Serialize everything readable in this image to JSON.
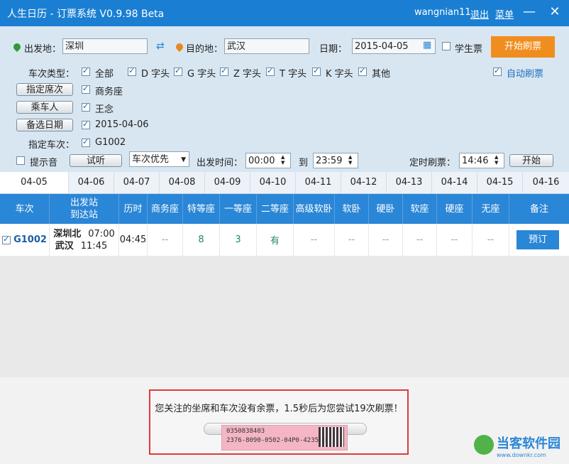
{
  "window": {
    "title": "人生日历 - 订票系统 V0.9.98 Beta",
    "user": "wangnian11",
    "logout": "退出",
    "menu": "菜单",
    "minimize_icon": "minimize-icon",
    "close_icon": "close-icon"
  },
  "search": {
    "from_label": "出发地：",
    "from_value": "深圳",
    "to_label": "目的地：",
    "to_value": "武汉",
    "date_label": "日期：",
    "date_value": "2015-04-05",
    "student_label": "学生票",
    "start_label": "开始刷票"
  },
  "filters": {
    "train_type_label": "车次类型：",
    "types": [
      "全部",
      "D 字头",
      "G 字头",
      "Z 字头",
      "T 字头",
      "K 字头",
      "其他"
    ],
    "auto_refresh_label": "自动刷票"
  },
  "options": {
    "seat_button": "指定席次",
    "seat_value": "商务座",
    "passenger_button": "乘车人",
    "passenger_value": "王念",
    "backup_date_button": "备选日期",
    "backup_date_value": "2015-04-06",
    "train_label": "指定车次：",
    "train_value": "G1002"
  },
  "controls": {
    "sound_label": "提示音",
    "listen_button": "试听",
    "priority_select": "车次优先",
    "depart_time_label": "出发时间：",
    "time_from": "00:00",
    "to_label": "到",
    "time_to": "23:59",
    "timer_label": "定时刷票：",
    "timer_value": "14:46",
    "timer_start": "开始"
  },
  "dates": [
    "04-05",
    "04-06",
    "04-07",
    "04-08",
    "04-09",
    "04-10",
    "04-11",
    "04-12",
    "04-13",
    "04-14",
    "04-15",
    "04-16"
  ],
  "table": {
    "headers": [
      "车次",
      "出发站\n到达站",
      "历时",
      "商务座",
      "特等座",
      "一等座",
      "二等座",
      "高级软卧",
      "软卧",
      "硬卧",
      "软座",
      "硬座",
      "无座",
      "备注"
    ],
    "row": {
      "train": "G1002",
      "from_station": "深圳北",
      "to_station": "武汉",
      "depart": "07:00",
      "arrive": "11:45",
      "duration": "04:45",
      "cells": [
        "--",
        "8",
        "3",
        "有",
        "--",
        "--",
        "--",
        "--",
        "--",
        "--"
      ],
      "action": "预订"
    }
  },
  "notice": {
    "message": "您关注的坐席和车次没有余票，1.5秒后为您尝试19次刷票！",
    "ticket_line1": "0350838403",
    "ticket_line2": "2376-8090-0502-04P0-4235-3"
  },
  "watermark": {
    "text": "当客软件园",
    "sub": "www.downkr.com"
  },
  "colors": {
    "titlebar": "#1a7fd2",
    "panel": "#d8e6f1",
    "start_button": "#f08d1f",
    "table_header": "#2a86d6",
    "notice_border": "#e03a3a"
  }
}
